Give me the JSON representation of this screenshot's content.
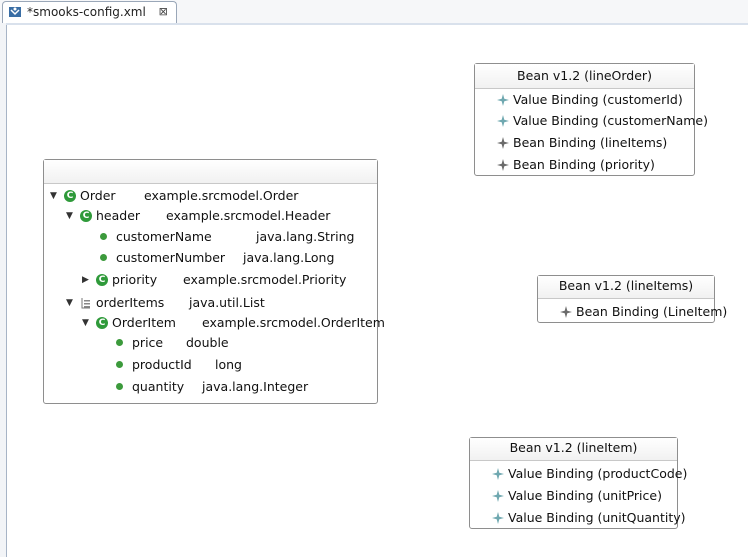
{
  "editor_tab": {
    "title": "*smooks-config.xml",
    "close": "⊠"
  },
  "model": {
    "rows": [
      {
        "name": "Order",
        "type": "example.srcmodel.Order"
      },
      {
        "name": "header",
        "type": "example.srcmodel.Header"
      },
      {
        "name": "customerName",
        "type": "java.lang.String"
      },
      {
        "name": "customerNumber",
        "type": "java.lang.Long"
      },
      {
        "name": "priority",
        "type": "example.srcmodel.Priority"
      },
      {
        "name": "orderItems",
        "type": "java.util.List"
      },
      {
        "name": "OrderItem",
        "type": "example.srcmodel.OrderItem"
      },
      {
        "name": "price",
        "type": "double"
      },
      {
        "name": "productId",
        "type": "long"
      },
      {
        "name": "quantity",
        "type": "java.lang.Integer"
      }
    ]
  },
  "bean_line_order": {
    "title": "Bean v1.2 (lineOrder)",
    "bindings": [
      "Value Binding (customerId)",
      "Value Binding (customerName)",
      "Bean Binding (lineItems)",
      "Bean Binding (priority)"
    ]
  },
  "bean_line_items": {
    "title": "Bean v1.2 (lineItems)",
    "bindings": [
      "Bean Binding (LineItem)"
    ]
  },
  "bean_line_item": {
    "title": "Bean v1.2 (lineItem)",
    "bindings": [
      "Value Binding (productCode)",
      "Value Binding (unitPrice)",
      "Value Binding (unitQuantity)"
    ]
  },
  "icons": {
    "tab": "smooks-config-icon",
    "class": "class-icon",
    "field": "field-icon",
    "list": "list-icon",
    "value_binding": "value-binding-icon",
    "bean_binding": "bean-binding-icon"
  },
  "colors": {
    "class_icon": "#2f9a3a",
    "field_icon": "#3c9a3c",
    "value_binding": "#6fa8b0",
    "bean_binding": "#6b6b6b"
  }
}
